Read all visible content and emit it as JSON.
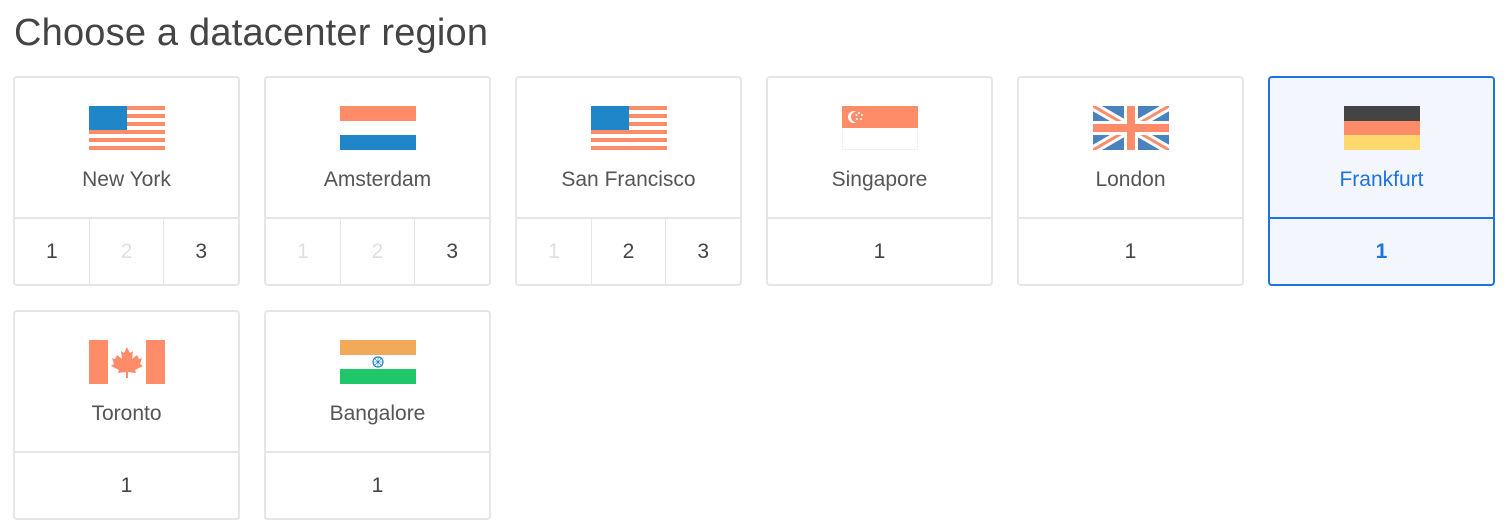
{
  "title": "Choose a datacenter region",
  "colors": {
    "selected_accent": "#1d73e0",
    "selected_background": "#f3f7fd",
    "card_border": "#e6e6e6",
    "flag_orange": "#ff8c69",
    "flag_blue": "#1f86c8",
    "flag_yellow": "#ffd86e",
    "flag_dark": "#444444",
    "flag_green": "#1dc76a",
    "flag_saffron": "#f2a95a"
  },
  "regions": [
    {
      "id": "nyc",
      "label": "New York",
      "flag_icon": "us-flag-icon",
      "selected": false,
      "datacenters": [
        {
          "label": "1",
          "available": true
        },
        {
          "label": "2",
          "available": false
        },
        {
          "label": "3",
          "available": true
        }
      ]
    },
    {
      "id": "ams",
      "label": "Amsterdam",
      "flag_icon": "netherlands-flag-icon",
      "selected": false,
      "datacenters": [
        {
          "label": "1",
          "available": false
        },
        {
          "label": "2",
          "available": false
        },
        {
          "label": "3",
          "available": true
        }
      ]
    },
    {
      "id": "sfo",
      "label": "San Francisco",
      "flag_icon": "us-flag-icon",
      "selected": false,
      "datacenters": [
        {
          "label": "1",
          "available": false
        },
        {
          "label": "2",
          "available": true
        },
        {
          "label": "3",
          "available": true
        }
      ]
    },
    {
      "id": "sgp",
      "label": "Singapore",
      "flag_icon": "singapore-flag-icon",
      "selected": false,
      "datacenters": [
        {
          "label": "1",
          "available": true
        }
      ]
    },
    {
      "id": "lon",
      "label": "London",
      "flag_icon": "uk-flag-icon",
      "selected": false,
      "datacenters": [
        {
          "label": "1",
          "available": true
        }
      ]
    },
    {
      "id": "fra",
      "label": "Frankfurt",
      "flag_icon": "germany-flag-icon",
      "selected": true,
      "datacenters": [
        {
          "label": "1",
          "available": true
        }
      ]
    },
    {
      "id": "tor",
      "label": "Toronto",
      "flag_icon": "canada-flag-icon",
      "selected": false,
      "datacenters": [
        {
          "label": "1",
          "available": true
        }
      ]
    },
    {
      "id": "blr",
      "label": "Bangalore",
      "flag_icon": "india-flag-icon",
      "selected": false,
      "datacenters": [
        {
          "label": "1",
          "available": true
        }
      ]
    }
  ]
}
